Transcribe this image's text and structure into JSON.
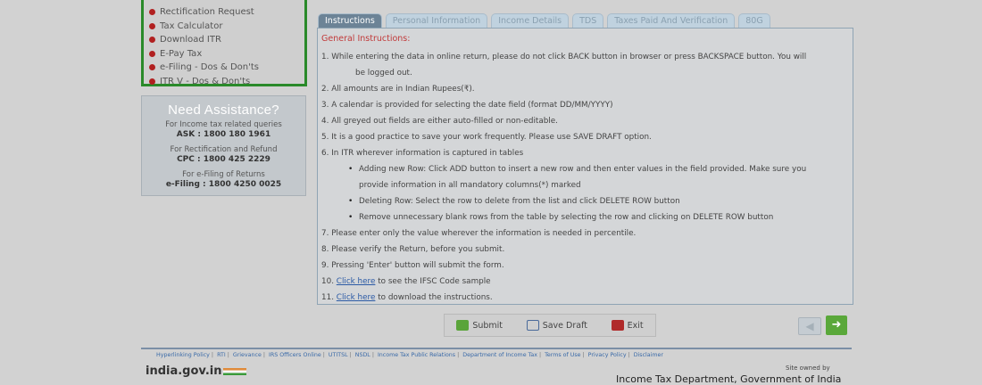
{
  "sidebar": {
    "links": [
      "Rectification Request",
      "Tax Calculator",
      "Download ITR",
      "E-Pay Tax",
      "e-Filing - Dos & Don'ts",
      "ITR V - Dos & Don'ts"
    ]
  },
  "assistance": {
    "title": "Need Assistance?",
    "ask_label": "For Income tax related queries",
    "ask_number": "ASK : 1800 180 1961",
    "cpc_label": "For Rectification and Refund",
    "cpc_number": "CPC : 1800 425 2229",
    "efiling_label": "For e-Filing of Returns",
    "efiling_number": "e-Filing : 1800 4250 0025"
  },
  "tabs": [
    "Instructions",
    "Personal Information",
    "Income Details",
    "TDS",
    "Taxes Paid And Verification",
    "80G"
  ],
  "instructions": {
    "heading": "General Instructions:",
    "items": [
      "1. While entering the data in online return, please do not click BACK button in browser or press BACKSPACE button. You will",
      "be logged out.",
      "2. All amounts are in Indian Rupees(₹).",
      "3. A calendar is provided for selecting the date field (format DD/MM/YYYY)",
      "4. All greyed out fields are either auto-filled or non-editable.",
      "5. It is a good practice to save your work frequently. Please use SAVE DRAFT option.",
      "6. In ITR wherever information is captured in tables",
      "Adding new Row: Click ADD button to insert a new row and then enter values in the field provided. Make sure you",
      "provide information in all mandatory columns(*) marked",
      "Deleting Row: Select the row to delete from the list and click DELETE ROW button",
      "Remove unnecessary blank rows from the table by selecting the row and clicking on DELETE ROW button",
      "7. Please enter only the value wherever the information is needed in percentile.",
      "8. Please verify the Return, before you submit.",
      "9. Pressing 'Enter' button will submit the form."
    ],
    "item10_prefix": "10.",
    "item10_link": "Click here",
    "item10_suffix": "to see the IFSC Code sample",
    "item11_prefix": "11.",
    "item11_link": "Click here",
    "item11_suffix": "to download the instructions."
  },
  "actions": {
    "submit": "Submit",
    "save_draft": "Save Draft",
    "exit": "Exit"
  },
  "footer": {
    "links": [
      "Hyperlinking Policy",
      "RTI",
      "Grievance",
      "IRS Officers Online",
      "UTITSL",
      "NSDL",
      "Income Tax Public Relations",
      "Department of Income Tax",
      "Terms of Use",
      "Privacy Policy",
      "Disclaimer"
    ],
    "brand": "india.gov.in",
    "owned": "Site owned by",
    "department": "Income Tax Department, Government of India"
  },
  "colors": {
    "accent_green": "#5aa83a",
    "tab_active": "#6c8396",
    "heading_red": "#c13a3a"
  }
}
